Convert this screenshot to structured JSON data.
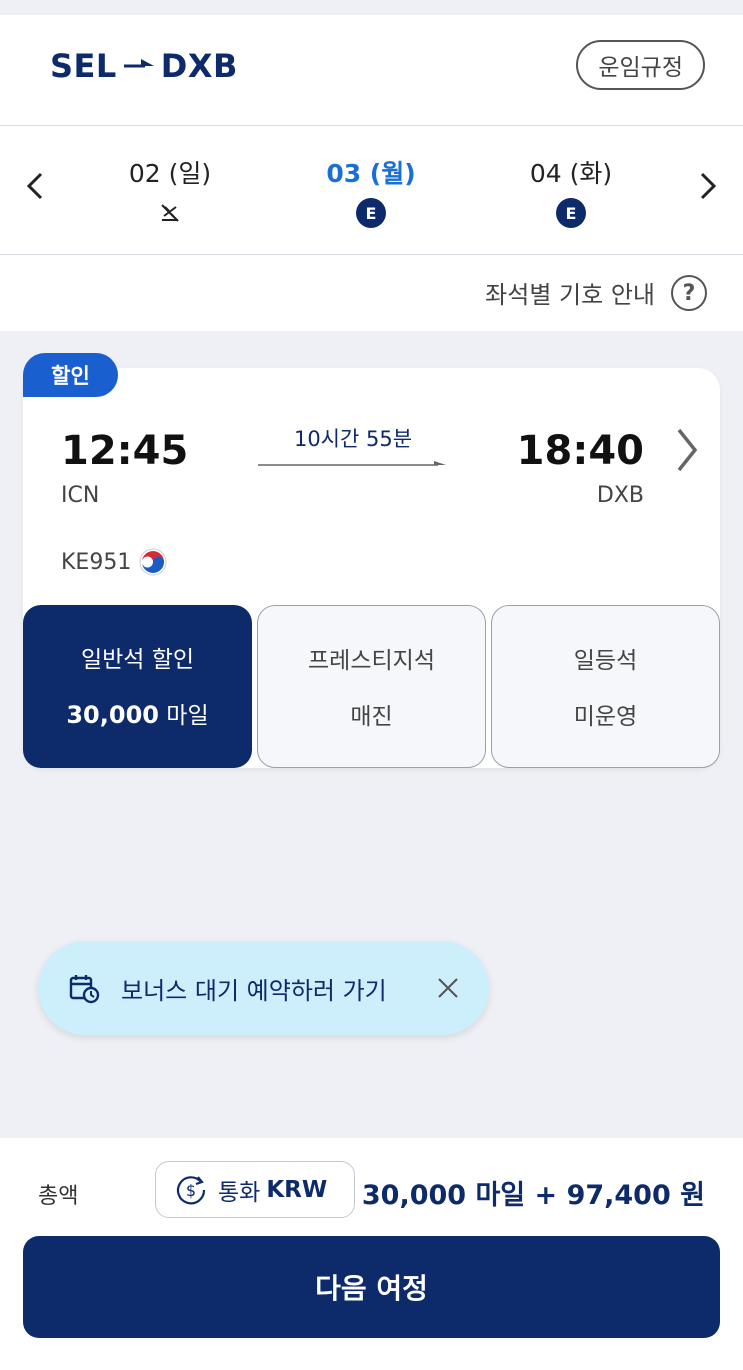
{
  "header": {
    "origin": "SEL",
    "destination": "DXB",
    "fare_rules_label": "운임규정"
  },
  "dates": [
    {
      "label": "02 (일)",
      "status_icon": "no-flight-icon",
      "active": false
    },
    {
      "label": "03 (월)",
      "status_badge": "E",
      "active": true
    },
    {
      "label": "04 (화)",
      "status_badge": "E",
      "active": false
    }
  ],
  "legend": {
    "label": "좌석별 기호 안내",
    "help_symbol": "?"
  },
  "flight": {
    "tag": "할인",
    "departure_time": "12:45",
    "departure_code": "ICN",
    "arrival_time": "18:40",
    "arrival_code": "DXB",
    "duration": "10시간 55분",
    "flight_number": "KE951",
    "airline_logo": "korean-air-logo"
  },
  "fares": [
    {
      "name": "일반석 할인",
      "value_bold": "30,000",
      "value_unit": " 마일",
      "selected": true
    },
    {
      "name": "프레스티지석",
      "value": "매진",
      "selected": false
    },
    {
      "name": "일등석",
      "value": "미운영",
      "selected": false
    }
  ],
  "waitlist": {
    "label": "보너스 대기 예약하러 가기"
  },
  "bottom": {
    "total_label": "총액",
    "currency_prefix": "통화",
    "currency_code": "KRW",
    "total_amount": "30,000 마일 + 97,400 원",
    "next_button": "다음 여정"
  },
  "colors": {
    "brand_navy": "#0d2b6b",
    "active_blue": "#1a6fd6",
    "discount_blue": "#1a5fd0",
    "waitlist_bg": "#cdeefb"
  }
}
